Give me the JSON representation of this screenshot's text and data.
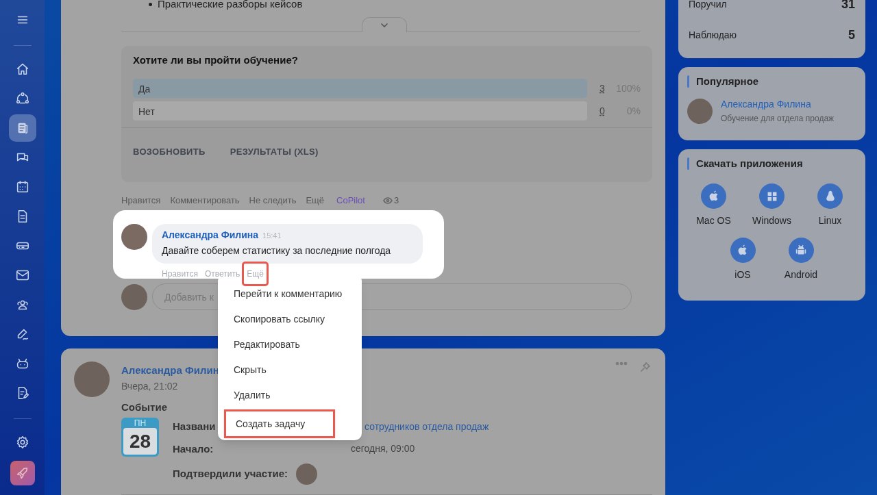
{
  "sidebar": {
    "items": [
      {
        "selected": false
      },
      {
        "selected": false
      },
      {
        "selected": false
      },
      {
        "selected": true
      },
      {
        "selected": false
      },
      {
        "selected": false
      },
      {
        "selected": false
      },
      {
        "selected": false
      },
      {
        "selected": false
      },
      {
        "selected": false
      },
      {
        "selected": false
      },
      {
        "selected": false
      },
      {
        "selected": false
      }
    ],
    "bottom": [
      {
        "selected": false
      },
      {
        "selected": false
      }
    ]
  },
  "post": {
    "bullet": "Практические разборы кейсов",
    "poll": {
      "question": "Хотите ли вы пройти обучение?",
      "options": [
        {
          "label": "Да",
          "level": 1,
          "count": "3",
          "percent": "100%"
        },
        {
          "label": "Нет",
          "level": 0,
          "count": "0",
          "percent": "0%"
        }
      ],
      "buttons": [
        "ВОЗОБНОВИТЬ",
        "РЕЗУЛЬТАТЫ (XLS)"
      ]
    },
    "actions": [
      {
        "label": "Нравится",
        "kind": "plain"
      },
      {
        "label": "Комментировать",
        "kind": "plain"
      },
      {
        "label": "Не следить",
        "kind": "plain"
      },
      {
        "label": "Ещё",
        "kind": "plain"
      },
      {
        "label": "CoPilot",
        "kind": "accent"
      }
    ],
    "views": "3",
    "comment": {
      "author": "Александра Филина",
      "time": "15:41",
      "text": "Давайте соберем статистику за последние полгода",
      "actions": [
        {
          "label": "Нравится",
          "highlighted": false
        },
        {
          "label": "Ответить",
          "highlighted": false
        },
        {
          "label": "Ещё",
          "highlighted": true
        }
      ]
    },
    "comment_field": {
      "placeholder": "Добавить к"
    }
  },
  "menu": {
    "items": [
      {
        "label": "Перейти к комментарию",
        "highlighted": false
      },
      {
        "label": "Скопировать ссылку",
        "highlighted": false
      },
      {
        "label": "Редактировать",
        "highlighted": false
      },
      {
        "label": "Скрыть",
        "highlighted": false
      },
      {
        "label": "Удалить",
        "highlighted": false
      },
      {
        "label": "Создать задачу",
        "highlighted": true
      }
    ]
  },
  "event_post": {
    "author": "Александра Филин",
    "time": "Вчера, 21:02",
    "heading": "Событие",
    "weekday": "ПН",
    "day": "28",
    "fields": [
      {
        "label": "Названи",
        "value": "сотрудников отдела продаж",
        "kind": "link"
      },
      {
        "label": "Начало:",
        "value": "сегодня, 09:00",
        "kind": "text"
      },
      {
        "label": "Подтвердили участие:",
        "kind": "avatars"
      }
    ]
  },
  "tasks": [
    {
      "label": "Поручил",
      "count": "31"
    },
    {
      "label": "Наблюдаю",
      "count": "5"
    }
  ],
  "popular": {
    "title": "Популярное",
    "author": "Александра Филина",
    "subtitle": "Обучение для отдела продаж"
  },
  "apps": {
    "title": "Скачать приложения",
    "items": [
      {
        "label": "Mac OS"
      },
      {
        "label": "Windows"
      },
      {
        "label": "Linux"
      },
      {
        "label": "iOS"
      },
      {
        "label": "Android"
      }
    ]
  }
}
